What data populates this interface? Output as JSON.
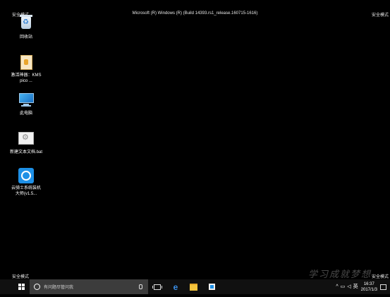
{
  "mode_label": "安全模式",
  "build_text": "Microsoft (R) Windows (R) (Build 14393.rs1_release.160715-1616)",
  "desktop_icons": [
    {
      "label": "回收站",
      "icon": "recycle-bin-icon"
    },
    {
      "label": "激活神器：KMSpico ...",
      "icon": "kmspico-file-icon"
    },
    {
      "label": "此电脑",
      "icon": "this-pc-icon"
    },
    {
      "label": "新建文本文档.bat",
      "icon": "bat-file-icon"
    },
    {
      "label": "云骑士系统装机大师(v1.5...",
      "icon": "app-icon"
    }
  ],
  "taskbar": {
    "search_placeholder": "有问题尽管问我",
    "tray_lang": "英",
    "time": "16:37",
    "date": "2017/1/3"
  },
  "watermark": "学习成就梦想",
  "colors": {
    "background": "#000000",
    "taskbar": "#101010",
    "search_box": "#3c3c3c",
    "accent": "#1e90e6"
  }
}
